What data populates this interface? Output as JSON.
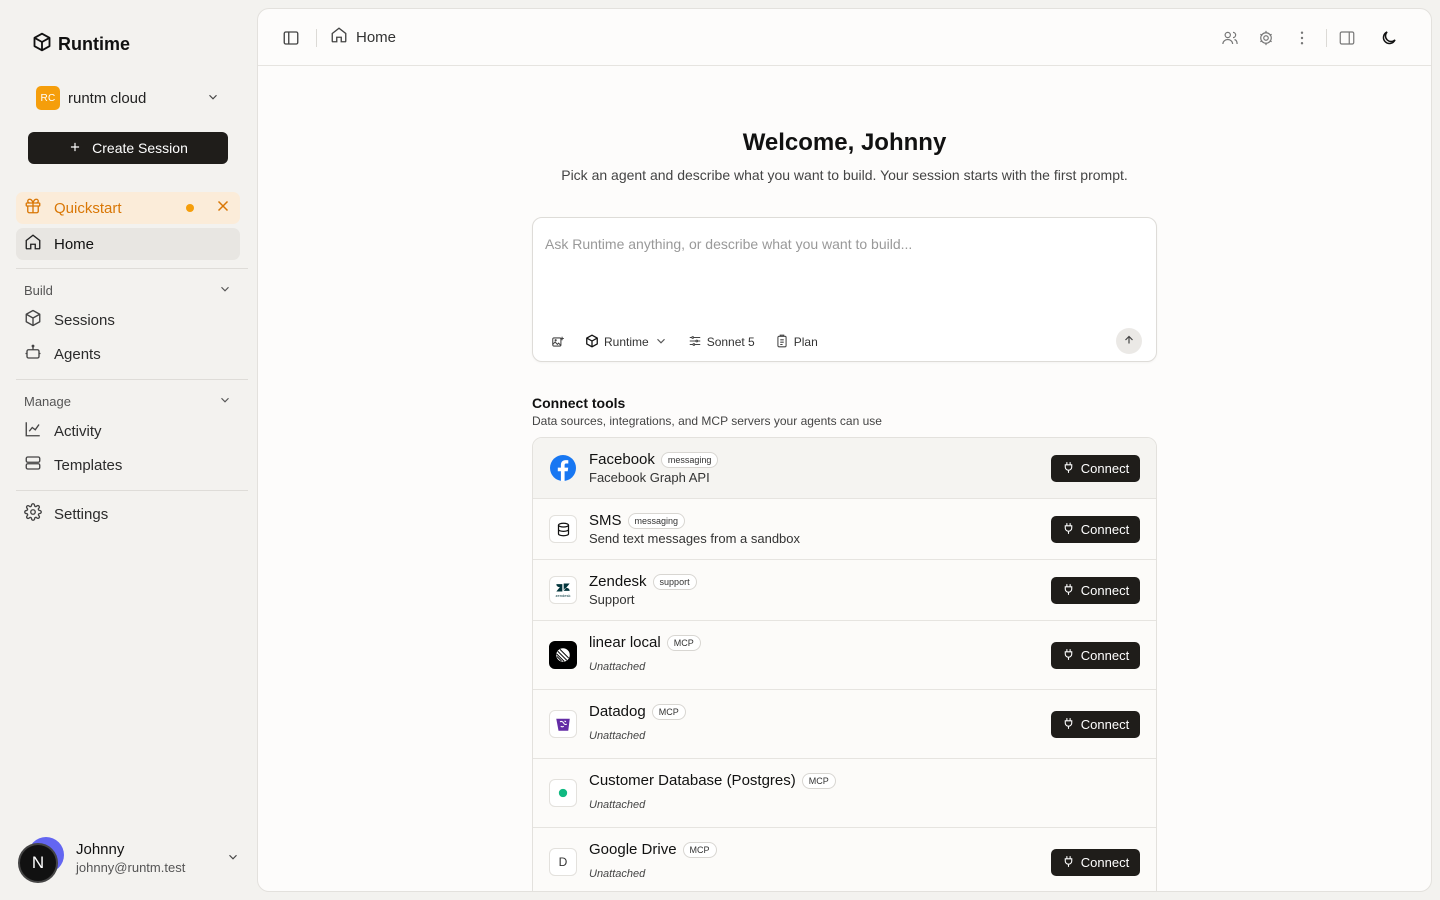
{
  "app": {
    "name": "Runtime"
  },
  "org": {
    "initials": "RC",
    "name": "runtm cloud"
  },
  "sidebar": {
    "create_label": "Create Session",
    "quickstart_label": "Quickstart",
    "home_label": "Home",
    "build_label": "Build",
    "sessions_label": "Sessions",
    "agents_label": "Agents",
    "manage_label": "Manage",
    "activity_label": "Activity",
    "templates_label": "Templates",
    "settings_label": "Settings"
  },
  "user": {
    "initial": "N",
    "name": "Johnny",
    "email": "johnny@runtm.test"
  },
  "header": {
    "breadcrumb": "Home"
  },
  "main": {
    "welcome": "Welcome, Johnny",
    "subtitle": "Pick an agent and describe what you want to build. Your session starts with the first prompt.",
    "prompt_placeholder": "Ask Runtime anything, or describe what you want to build...",
    "agent_label": "Runtime",
    "model_label": "Sonnet 5",
    "plan_label": "Plan"
  },
  "tools": {
    "title": "Connect tools",
    "subtitle": "Data sources, integrations, and MCP servers your agents can use",
    "connect_label": "Connect",
    "items": [
      {
        "name": "Facebook",
        "tag": "messaging",
        "desc": "Facebook Graph API",
        "icon": "facebook-icon"
      },
      {
        "name": "SMS",
        "tag": "messaging",
        "desc": "Send text messages from a sandbox",
        "icon": "database-icon"
      },
      {
        "name": "Zendesk",
        "tag": "support",
        "desc": "Support",
        "icon": "zendesk-logo-icon",
        "logo_text": "zendesk"
      },
      {
        "name": "linear local",
        "tag": "MCP",
        "desc": "Unattached",
        "icon": "linear-icon"
      },
      {
        "name": "Datadog",
        "tag": "MCP",
        "desc": "Unattached",
        "icon": "datadog-icon"
      },
      {
        "name": "Customer Database (Postgres)",
        "tag": "MCP",
        "desc": "Unattached",
        "icon": "green-dot-icon"
      },
      {
        "name": "Google Drive",
        "tag": "MCP",
        "desc": "Unattached",
        "icon": "letter-d-icon",
        "logo_text": "D"
      }
    ]
  },
  "colors": {
    "accent": "#f59e0b",
    "button": "#1f1d1a",
    "quickstart_bg": "#fbecd9",
    "quickstart_text": "#d97706"
  }
}
